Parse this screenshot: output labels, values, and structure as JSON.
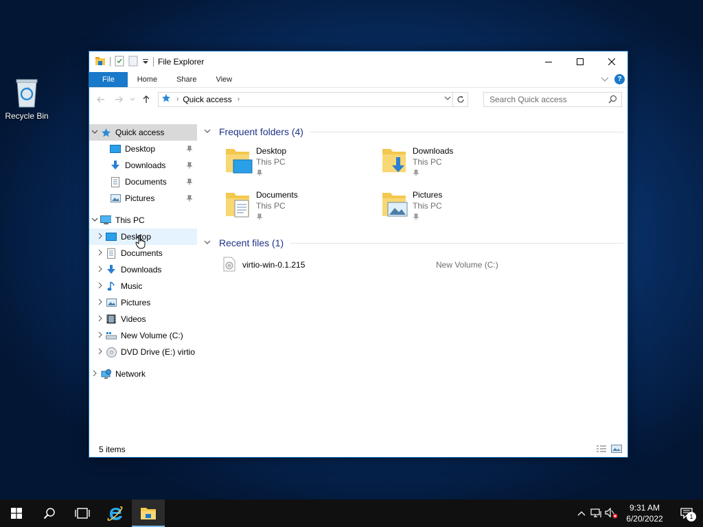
{
  "desktop": {
    "recycle_bin_label": "Recycle Bin"
  },
  "window": {
    "title": "File Explorer",
    "ribbon_tabs": [
      "File",
      "Home",
      "Share",
      "View"
    ],
    "address": {
      "crumb": "Quick access",
      "search_placeholder": "Search Quick access"
    },
    "nav": {
      "quick_access": {
        "label": "Quick access",
        "items": [
          "Desktop",
          "Downloads",
          "Documents",
          "Pictures"
        ]
      },
      "this_pc": {
        "label": "This PC",
        "items": [
          "Desktop",
          "Documents",
          "Downloads",
          "Music",
          "Pictures",
          "Videos",
          "New Volume (C:)",
          "DVD Drive (E:) virtio"
        ]
      },
      "network_label": "Network"
    },
    "frequent": {
      "header": "Frequent folders (4)",
      "folders": [
        {
          "name": "Desktop",
          "location": "This PC"
        },
        {
          "name": "Downloads",
          "location": "This PC"
        },
        {
          "name": "Documents",
          "location": "This PC"
        },
        {
          "name": "Pictures",
          "location": "This PC"
        }
      ]
    },
    "recent": {
      "header": "Recent files (1)",
      "files": [
        {
          "name": "virtio-win-0.1.215",
          "location": "New Volume (C:)"
        }
      ]
    },
    "status": "5 items"
  },
  "taskbar": {
    "time": "9:31 AM",
    "date": "6/20/2022",
    "notification_count": "1"
  },
  "colors": {
    "accent": "#1979ca",
    "group_header": "#1e3287",
    "folder_yellow": "#f4c84e"
  }
}
